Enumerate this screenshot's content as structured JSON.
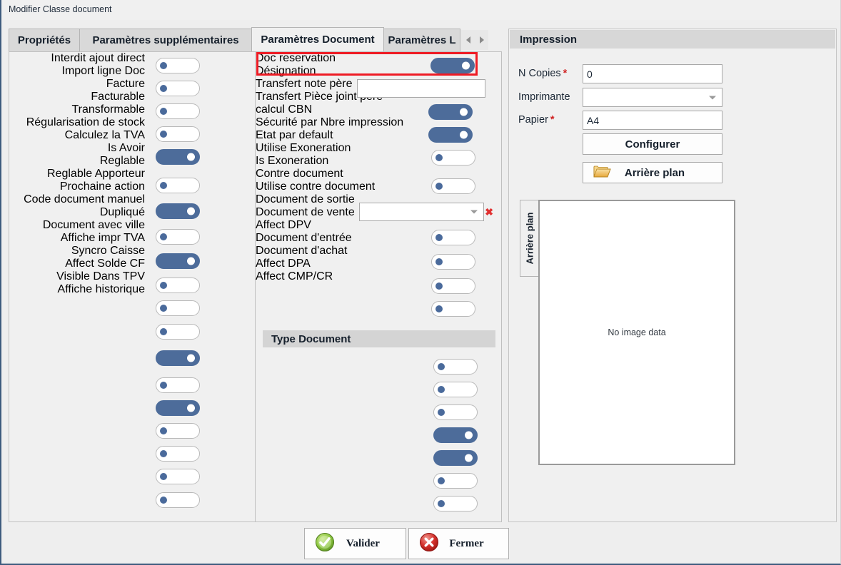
{
  "window": {
    "title": "Modifier Classe document"
  },
  "tabs": [
    {
      "label": "Propriétés",
      "active": false
    },
    {
      "label": "Paramètres supplémentaires",
      "active": false
    },
    {
      "label": "Paramètres Document",
      "active": true
    },
    {
      "label": "Paramètres L",
      "active": false
    }
  ],
  "tab_nav": {
    "prev_icon": "chevron-left-icon",
    "next_icon": "chevron-right-icon"
  },
  "left_panel": {
    "items": [
      {
        "label": "Interdit ajout direct",
        "state": "off"
      },
      {
        "label": "Import ligne Doc",
        "state": "off"
      },
      {
        "label": "Facture",
        "state": "off"
      },
      {
        "label": "Facturable",
        "state": "off"
      },
      {
        "label": "Transformable",
        "state": "on"
      },
      {
        "label": "Régularisation de stock",
        "state": "off"
      },
      {
        "label": "Calculez la TVA",
        "state": "on"
      },
      {
        "label": "Is Avoir",
        "state": "off"
      },
      {
        "label": "Reglable",
        "state": "on"
      },
      {
        "label": "Reglable Apporteur",
        "state": "off"
      },
      {
        "label": "Prochaine action",
        "state": "off"
      },
      {
        "label": "Code document manuel",
        "state": "off"
      },
      {
        "label": "Dupliqué",
        "state": "on"
      },
      {
        "label": "Document avec ville",
        "state": "off"
      },
      {
        "label": "Affiche impr TVA",
        "state": "on"
      },
      {
        "label": "Syncro Caisse",
        "state": "off"
      },
      {
        "label": "Affect Solde CF",
        "state": "off"
      },
      {
        "label": "Visible Dans TPV",
        "state": "off"
      },
      {
        "label": "Affiche historique",
        "state": "off"
      }
    ]
  },
  "mid_panel": {
    "top_items": [
      {
        "label": "Doc reservation",
        "type": "toggle",
        "state": "on",
        "highlighted": true
      },
      {
        "label": "Désignation",
        "type": "text",
        "value": "",
        "placeholder": ""
      },
      {
        "label": "Transfert note père",
        "type": "toggle",
        "state": "on"
      },
      {
        "label": "Transfert Pièce joint père",
        "type": "toggle",
        "state": "on"
      },
      {
        "label": "calcul CBN",
        "type": "toggle",
        "state": "off"
      },
      {
        "label": "Sécurité par Nbre impression",
        "type": "toggle",
        "state": "off"
      },
      {
        "label": "Etat par default",
        "type": "combo",
        "value": "",
        "clear_icon": "clear-x-icon"
      },
      {
        "label": "Utilise Exoneration",
        "type": "toggle",
        "state": "off"
      },
      {
        "label": "Is Exoneration",
        "type": "toggle",
        "state": "off"
      },
      {
        "label": "Contre document",
        "type": "toggle",
        "state": "off"
      },
      {
        "label": "Utilise contre document",
        "type": "toggle",
        "state": "off"
      }
    ],
    "section_title": "Type Document",
    "type_items": [
      {
        "label": "Document de sortie",
        "state": "off"
      },
      {
        "label": "Document de vente",
        "state": "off"
      },
      {
        "label": "Affect DPV",
        "state": "off"
      },
      {
        "label": "Document d'entrée",
        "state": "on"
      },
      {
        "label": "Document d'achat",
        "state": "on"
      },
      {
        "label": "Affect DPA",
        "state": "off"
      },
      {
        "label": "Affect CMP/CR",
        "state": "off"
      }
    ]
  },
  "right_panel": {
    "group_title": "Impression",
    "fields": [
      {
        "label": "N Copies",
        "required": true,
        "type": "text",
        "value": "0"
      },
      {
        "label": "Imprimante",
        "required": false,
        "type": "combo",
        "value": ""
      },
      {
        "label": "Papier",
        "required": true,
        "type": "text",
        "value": "A4"
      }
    ],
    "configure_button": "Configurer",
    "background_button": "Arrière plan",
    "background_button_icon": "folder-icon",
    "preview_tab_label": "Arrière plan",
    "preview_placeholder": "No image data"
  },
  "footer": {
    "validate_label": "Valider",
    "validate_icon": "green-check-circle-icon",
    "close_label": "Fermer",
    "close_icon": "red-x-circle-icon"
  },
  "colors": {
    "toggle_on": "#4d6c9a",
    "toggle_dot": "#4a6a9b",
    "highlight": "#ee1b24",
    "required_star": "#d02424",
    "window_border": "#3e5b7e"
  }
}
